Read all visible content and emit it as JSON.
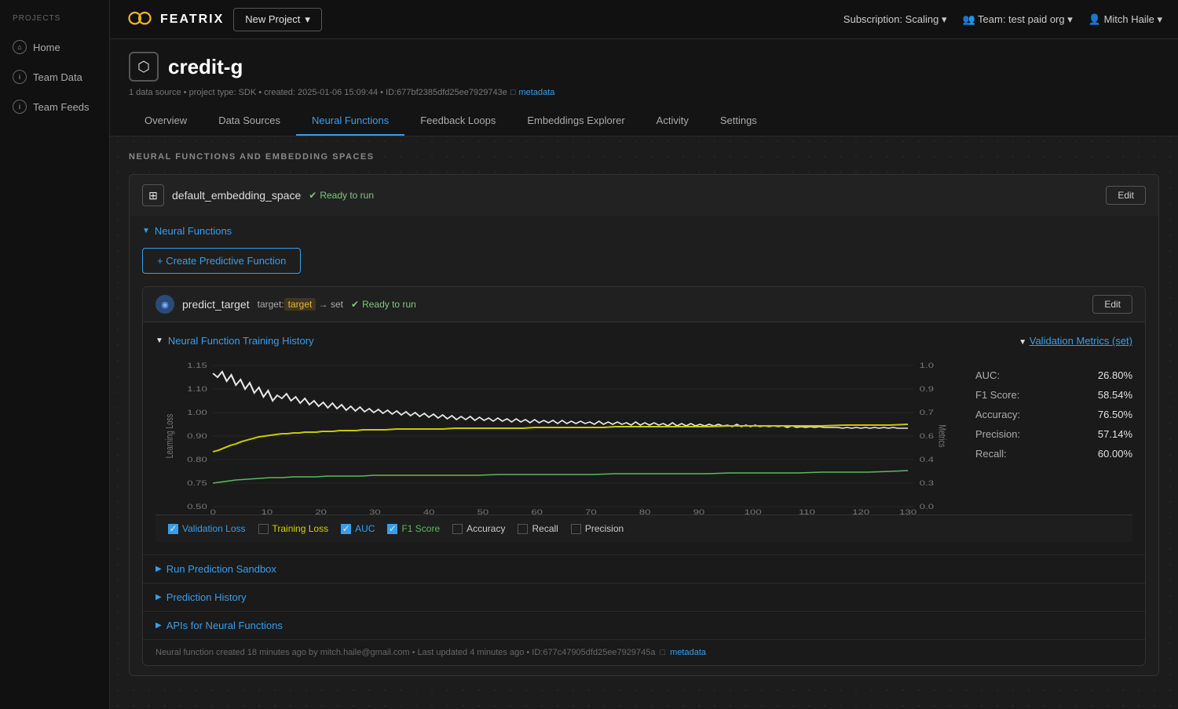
{
  "topnav": {
    "logo_text": "FEATRIX",
    "new_project_label": "New Project",
    "subscription_label": "Subscription: Scaling",
    "team_label": "Team: test paid org",
    "user_label": "Mitch Haile"
  },
  "sidebar": {
    "projects_label": "PROJECTS",
    "items": [
      {
        "label": "Home",
        "icon": "⌂"
      },
      {
        "label": "Team Data",
        "icon": "i"
      },
      {
        "label": "Team Feeds",
        "icon": "i"
      }
    ]
  },
  "project": {
    "name": "credit-g",
    "meta": "1 data source  •  project type: SDK  •  created: 2025-01-06 15:09:44  •  ID:677bf2385dfd25ee7929743e",
    "metadata_link": "metadata",
    "tabs": [
      {
        "label": "Overview",
        "active": false
      },
      {
        "label": "Data Sources",
        "active": false
      },
      {
        "label": "Neural Functions",
        "active": true
      },
      {
        "label": "Feedback Loops",
        "active": false
      },
      {
        "label": "Embeddings Explorer",
        "active": false
      },
      {
        "label": "Activity",
        "active": false
      },
      {
        "label": "Settings",
        "active": false
      }
    ]
  },
  "page": {
    "section_title": "NEURAL FUNCTIONS AND EMBEDDING SPACES",
    "embedding_name": "default_embedding_space",
    "ready_status": "Ready to run",
    "edit_label": "Edit",
    "neural_functions_label": "Neural Functions",
    "create_btn_label": "+ Create Predictive Function",
    "predict_target": {
      "name": "predict_target",
      "target_prefix": "target:",
      "target_word": "target",
      "target_suffix": "→ set",
      "ready_label": "Ready to run",
      "edit_label": "Edit"
    },
    "training_history": {
      "label": "Neural Function Training History",
      "validation_metrics_label": "Validation Metrics (set)",
      "metrics": [
        {
          "label": "AUC:",
          "value": "26.80%"
        },
        {
          "label": "F1 Score:",
          "value": "58.54%"
        },
        {
          "label": "Accuracy:",
          "value": "76.50%"
        },
        {
          "label": "Precision:",
          "value": "57.14%"
        },
        {
          "label": "Recall:",
          "value": "60.00%"
        }
      ]
    },
    "legend": [
      {
        "label": "Validation Loss",
        "checked": true,
        "color": "#3a9de8"
      },
      {
        "label": "Training Loss",
        "checked": false,
        "color": "#888"
      },
      {
        "label": "AUC",
        "checked": true,
        "color": "#3a9de8"
      },
      {
        "label": "F1 Score",
        "checked": true,
        "color": "#5cb85c"
      },
      {
        "label": "Accuracy",
        "checked": false,
        "color": "#888"
      },
      {
        "label": "Recall",
        "checked": false,
        "color": "#888"
      },
      {
        "label": "Precision",
        "checked": false,
        "color": "#888"
      }
    ],
    "run_prediction_label": "Run Prediction Sandbox",
    "prediction_history_label": "Prediction History",
    "apis_label": "APIs for Neural Functions",
    "footer_text": "Neural function created 18 minutes ago by mitch.haile@gmail.com  •  Last updated 4 minutes ago  •  ID:677c47905dfd25ee7929745a",
    "footer_metadata": "metadata"
  }
}
